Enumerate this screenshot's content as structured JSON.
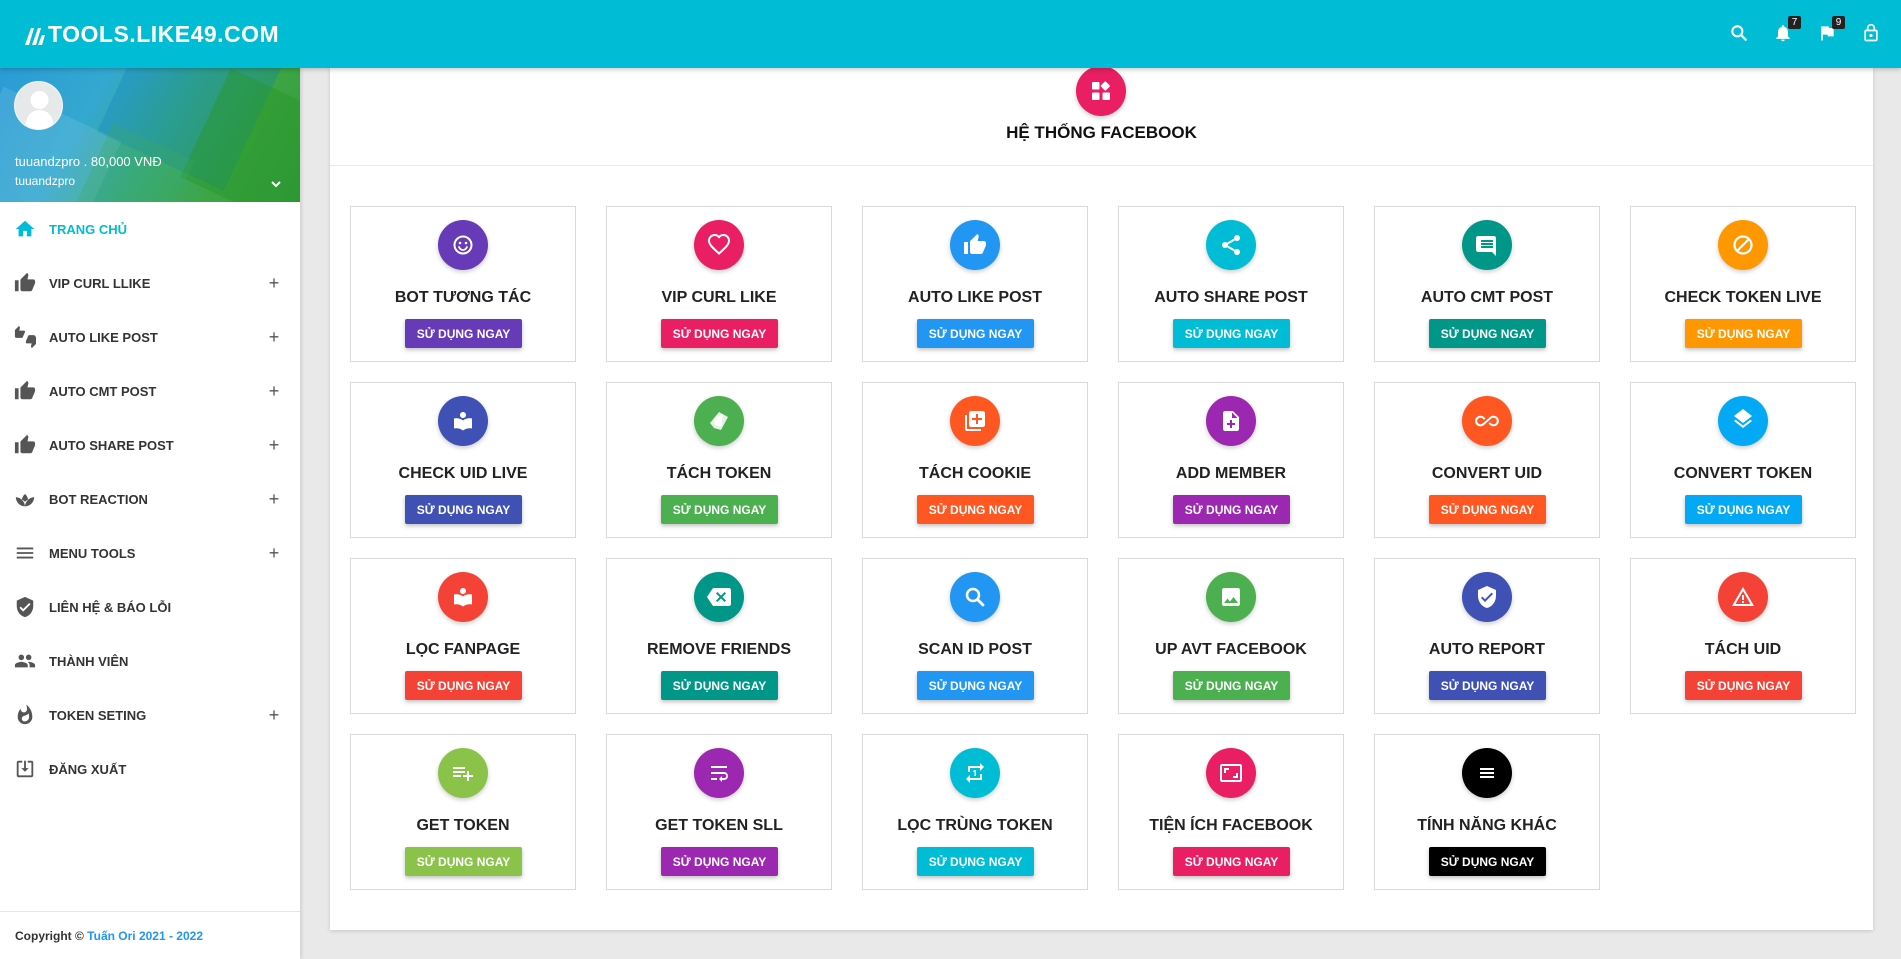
{
  "brand": {
    "text": "TOOLS.LIKE49.COM"
  },
  "topbar": {
    "notifications_count": "7",
    "flags_count": "9"
  },
  "user": {
    "name_balance": "tuuandzpro . 80,000 VNĐ",
    "username": "tuuandzpro"
  },
  "sidebar": {
    "items": [
      {
        "label": "TRANG CHỦ",
        "icon": "home-icon",
        "expandable": false,
        "active": true
      },
      {
        "label": "VIP CURL LLIKE",
        "icon": "thumb-up-icon",
        "expandable": true
      },
      {
        "label": "AUTO LIKE POST",
        "icon": "thumbs-up-down-icon",
        "expandable": true
      },
      {
        "label": "AUTO CMT POST",
        "icon": "thumb-up-icon",
        "expandable": true
      },
      {
        "label": "AUTO SHARE POST",
        "icon": "thumb-up-icon",
        "expandable": true
      },
      {
        "label": "BOT REACTION",
        "icon": "spa-icon",
        "expandable": true
      },
      {
        "label": "MENU TOOLS",
        "icon": "menu-icon",
        "expandable": true
      },
      {
        "label": "LIÊN HỆ & BÁO LỖI",
        "icon": "shield-check-icon",
        "expandable": false
      },
      {
        "label": "THÀNH VIÊN",
        "icon": "people-icon",
        "expandable": false
      },
      {
        "label": "TOKEN SETING",
        "icon": "flame-icon",
        "expandable": true
      },
      {
        "label": "ĐĂNG XUẤT",
        "icon": "logout-icon",
        "expandable": false
      }
    ],
    "plus_symbol": "+"
  },
  "copyright": {
    "prefix": "Copyright © ",
    "author": "Tuấn Ori 2021 - 2022"
  },
  "main": {
    "title": "HỆ THỐNG FACEBOOK",
    "button_label": "SỬ DỤNG NGAY",
    "tools": [
      {
        "name": "BOT TƯƠNG TÁC",
        "icon": "smile-icon",
        "color": "#673ab7"
      },
      {
        "name": "VIP CURL LIKE",
        "icon": "heart-icon",
        "color": "#e91e63"
      },
      {
        "name": "AUTO LIKE POST",
        "icon": "thumb-up-icon",
        "color": "#2196f3"
      },
      {
        "name": "AUTO SHARE POST",
        "icon": "share-icon",
        "color": "#00bcd4"
      },
      {
        "name": "AUTO CMT POST",
        "icon": "comment-icon",
        "color": "#009688"
      },
      {
        "name": "CHECK TOKEN LIVE",
        "icon": "block-icon",
        "color": "#ff9800"
      },
      {
        "name": "CHECK UID LIVE",
        "icon": "book-icon",
        "color": "#3f51b5"
      },
      {
        "name": "TÁCH TOKEN",
        "icon": "tag-icon",
        "color": "#4caf50"
      },
      {
        "name": "TÁCH COOKIE",
        "icon": "library-add-icon",
        "color": "#ff5722"
      },
      {
        "name": "ADD MEMBER",
        "icon": "note-add-icon",
        "color": "#9c27b0"
      },
      {
        "name": "CONVERT UID",
        "icon": "infinity-icon",
        "color": "#ff5722"
      },
      {
        "name": "CONVERT TOKEN",
        "icon": "layers-icon",
        "color": "#03a9f4"
      },
      {
        "name": "LỌC FANPAGE",
        "icon": "book-icon",
        "color": "#f44336"
      },
      {
        "name": "REMOVE FRIENDS",
        "icon": "backspace-icon",
        "color": "#009688"
      },
      {
        "name": "SCAN ID POST",
        "icon": "search-icon",
        "color": "#2196f3"
      },
      {
        "name": "UP AVT FACEBOOK",
        "icon": "image-icon",
        "color": "#4caf50"
      },
      {
        "name": "AUTO REPORT",
        "icon": "verified-icon",
        "color": "#3f51b5"
      },
      {
        "name": "TÁCH UID",
        "icon": "warning-icon",
        "color": "#f44336"
      },
      {
        "name": "GET TOKEN",
        "icon": "playlist-add-icon",
        "color": "#8bc34a"
      },
      {
        "name": "GET TOKEN SLL",
        "icon": "wrap-text-icon",
        "color": "#9c27b0"
      },
      {
        "name": "LỌC TRÙNG TOKEN",
        "icon": "repeat-icon",
        "color": "#00bcd4"
      },
      {
        "name": "TIỆN ÍCH FACEBOOK",
        "icon": "aspect-ratio-icon",
        "color": "#e91e63"
      },
      {
        "name": "TÍNH NĂNG KHÁC",
        "icon": "list-icon",
        "color": "#000000"
      }
    ]
  }
}
